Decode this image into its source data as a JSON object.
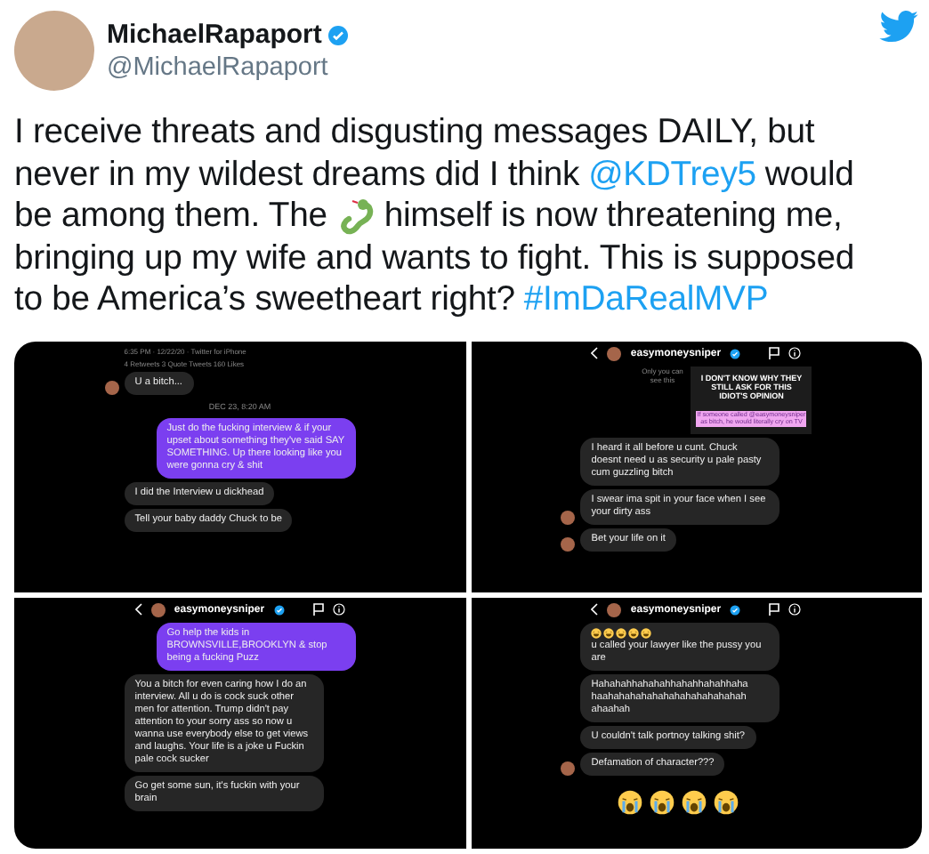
{
  "author": {
    "name": "MichaelRapaport",
    "verified": true,
    "handle": "@MichaelRapaport"
  },
  "tweet": {
    "lines": [
      [
        {
          "kind": "text",
          "text": "I receive threats and disgusting messages DAILY, but"
        }
      ],
      [
        {
          "kind": "text",
          "text": "never in my wildest dreams did I think"
        },
        {
          "kind": "link",
          "text": "@KDTrey5"
        },
        {
          "kind": "text",
          "text": "would"
        }
      ],
      [
        {
          "kind": "text",
          "text": "be among them. The"
        },
        {
          "kind": "emoji"
        },
        {
          "kind": "text",
          "text": "himself is now threatening me,"
        }
      ],
      [
        {
          "kind": "text",
          "text": "bringing up my wife and wants to fight. This is supposed"
        }
      ],
      [
        {
          "kind": "text",
          "text": "to be America’s sweetheart right?"
        },
        {
          "kind": "link",
          "text": "#ImDaRealMVP"
        }
      ]
    ]
  },
  "panels": [
    {
      "items": [
        {
          "kind": "meta",
          "text": "6:35 PM · 12/22/20 · Twitter for iPhone"
        },
        {
          "kind": "meta",
          "text": "4 Retweets 3 Quote Tweets 160 Likes"
        },
        {
          "kind": "received",
          "avatar": true,
          "text": "U a bitch..."
        },
        {
          "kind": "date",
          "text": "DEC 23, 8:20 AM"
        },
        {
          "kind": "sent",
          "text": "Just do the fucking interview & if your upset about something they've said SAY SOMETHING. Up there looking like you were gonna cry & shit"
        },
        {
          "kind": "received",
          "avatar": false,
          "text": "I did the Interview u dickhead"
        },
        {
          "kind": "received",
          "avatar": false,
          "text": "Tell your baby daddy Chuck to be"
        }
      ]
    },
    {
      "header": {
        "username": "easymoneysniper",
        "verified": true
      },
      "items": [
        {
          "kind": "image_card",
          "note": "Only you can see this",
          "headline": "I DON'T KNOW WHY THEY STILL ASK FOR THIS IDIOT'S OPINION",
          "caption": "If someone called @easymoneysniper as bitch, he would literally cry on TV"
        },
        {
          "kind": "received",
          "avatar": false,
          "text": "I heard it all before u cunt. Chuck doesnt need u as security u pale pasty cum guzzling bitch"
        },
        {
          "kind": "received",
          "avatar": true,
          "text": "I swear ima spit in your face when I see your dirty ass"
        },
        {
          "kind": "received",
          "avatar": true,
          "text": "Bet your life on it"
        }
      ]
    },
    {
      "header": {
        "username": "easymoneysniper",
        "verified": true
      },
      "items": [
        {
          "kind": "sent",
          "text": "Go help the kids in BROWNSVILLE,BROOKLYN & stop being a fucking Puzz"
        },
        {
          "kind": "received",
          "avatar": false,
          "text": "You a bitch for even caring how I do an interview. All u do is cock suck other men for attention. Trump didn't pay attention to your sorry ass so now u wanna use everybody else to get views and laughs.  Your life is a joke u Fuckin pale cock sucker"
        },
        {
          "kind": "received",
          "avatar": false,
          "text": "Go get some sun, it's fuckin with your brain"
        }
      ]
    },
    {
      "header": {
        "username": "easymoneysniper",
        "verified": true
      },
      "items": [
        {
          "kind": "received",
          "avatar": false,
          "emojis": [
            {
              "kind": "laughing"
            },
            {
              "kind": "laughing"
            },
            {
              "kind": "laughing"
            },
            {
              "kind": "laughing"
            },
            {
              "kind": "laughing"
            }
          ],
          "text": "u called your lawyer like  the pussy you are"
        },
        {
          "kind": "received",
          "avatar": false,
          "text": "Hahahahhahahahhahahhahahhaha haahahahahahahahahahahahahah ahaahah"
        },
        {
          "kind": "received",
          "avatar": false,
          "text": "U couldn't talk portnoy talking shit?"
        },
        {
          "kind": "received",
          "avatar": true,
          "text": "Defamation of character???"
        },
        {
          "kind": "emoji_row",
          "emojis": [
            {
              "kind": "crying"
            },
            {
              "kind": "crying"
            },
            {
              "kind": "crying"
            },
            {
              "kind": "crying"
            }
          ]
        }
      ]
    }
  ]
}
